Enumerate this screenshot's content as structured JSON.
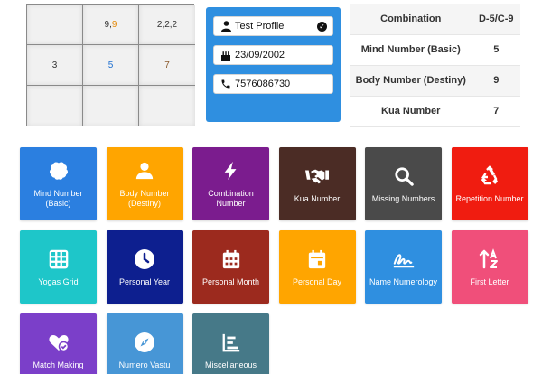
{
  "grid": {
    "cells": [
      {
        "parts": []
      },
      {
        "parts": [
          {
            "text": "9,",
            "color": "#333333"
          },
          {
            "text": "9",
            "color": "#e48a0b"
          }
        ]
      },
      {
        "parts": [
          {
            "text": "2,2,2",
            "color": "#333333"
          }
        ]
      },
      {
        "parts": [
          {
            "text": "3",
            "color": "#333333"
          }
        ]
      },
      {
        "parts": [
          {
            "text": "5",
            "color": "#1e6fd0"
          }
        ]
      },
      {
        "parts": [
          {
            "text": "7",
            "color": "#8a5a2c"
          }
        ]
      },
      {
        "parts": []
      },
      {
        "parts": []
      },
      {
        "parts": []
      }
    ]
  },
  "profile": {
    "name": "Test Profile",
    "dob": "23/09/2002",
    "phone": "7576086730",
    "bg_color": "#2f8fe0"
  },
  "summary": {
    "rows": [
      {
        "label": "Combination",
        "value": "D-5/C-9"
      },
      {
        "label": "Mind Number (Basic)",
        "value": "5"
      },
      {
        "label": "Body Number (Destiny)",
        "value": "9"
      },
      {
        "label": "Kua Number",
        "value": "7"
      }
    ]
  },
  "tiles": [
    {
      "label": "Mind Number (Basic)",
      "icon": "brain-icon",
      "color": "#2b7fe0"
    },
    {
      "label": "Body Number (Destiny)",
      "icon": "person-icon",
      "color": "#ffa500"
    },
    {
      "label": "Combination Number",
      "icon": "lightning-icon",
      "color": "#7b1c8e"
    },
    {
      "label": "Kua Number",
      "icon": "handshake-icon",
      "color": "#4b2c25"
    },
    {
      "label": "Missing Numbers",
      "icon": "magnifier-icon",
      "color": "#4a4a4a"
    },
    {
      "label": "Repetition Number",
      "icon": "recycle-icon",
      "color": "#f01c10"
    },
    {
      "label": "Yogas Grid",
      "icon": "grid-icon",
      "color": "#1ec6c9"
    },
    {
      "label": "Personal Year",
      "icon": "clock-icon",
      "color": "#0d1f8f"
    },
    {
      "label": "Personal Month",
      "icon": "calendar-month-icon",
      "color": "#9c2a1e"
    },
    {
      "label": "Personal Day",
      "icon": "calendar-day-icon",
      "color": "#ffa500"
    },
    {
      "label": "Name Numerology",
      "icon": "signature-icon",
      "color": "#2f8fe0"
    },
    {
      "label": "First Letter",
      "icon": "sort-alpha-icon",
      "color": "#f04f7a"
    },
    {
      "label": "Match Making",
      "icon": "heart-check-icon",
      "color": "#7b3fc9"
    },
    {
      "label": "Numero Vastu",
      "icon": "compass-icon",
      "color": "#4796d6"
    },
    {
      "label": "Miscellaneous",
      "icon": "chart-bars-icon",
      "color": "#467988"
    }
  ]
}
